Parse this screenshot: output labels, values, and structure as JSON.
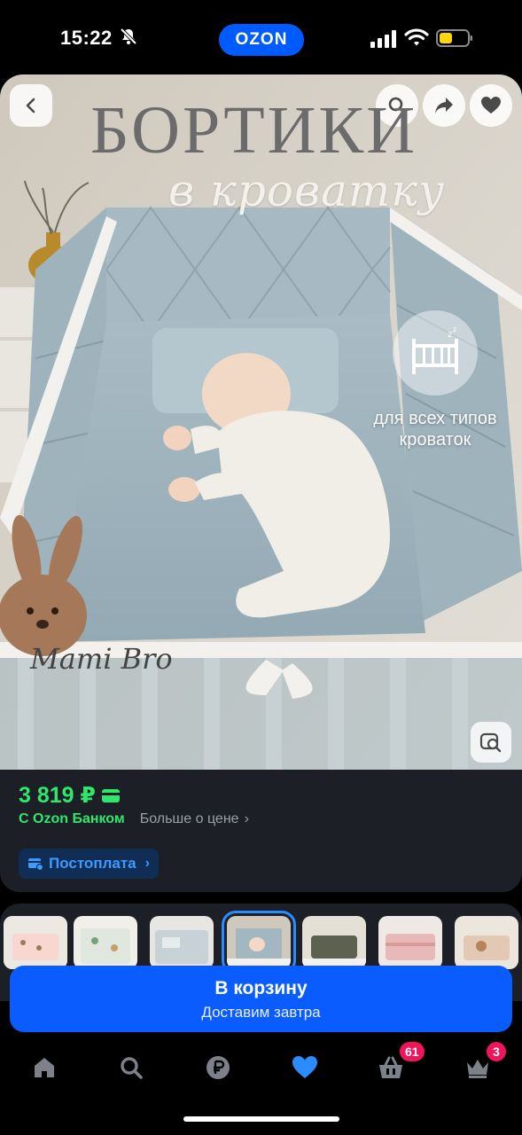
{
  "status": {
    "time": "15:22",
    "app_badge": "OZON",
    "battery_color": "#ffd60a"
  },
  "product": {
    "title_line1": "БОРТИКИ",
    "title_line2": "в кроватку",
    "badge_caption": "для всех типов кроваток",
    "brand": "Mami Bro"
  },
  "pricing": {
    "price": "3 819 ₽",
    "bank_label": "С Ozon Банком",
    "more_label": "Больше о цене",
    "postpay_label": "Постоплата"
  },
  "thumbnails": {
    "count": 7,
    "selected_index": 3
  },
  "cart": {
    "title": "В корзину",
    "subtitle": "Доставим завтра"
  },
  "tabbar": {
    "items": [
      "home-icon",
      "search-icon",
      "ruble-icon",
      "favorites-icon",
      "basket-icon",
      "crown-icon"
    ],
    "basket_badge": "61",
    "profile_badge": "3",
    "active": "favorites-icon"
  },
  "colors": {
    "ozon_blue": "#005bff",
    "price_green": "#2ee86b",
    "accent_blue": "#2a8cff",
    "badge_pink": "#f0155b"
  }
}
